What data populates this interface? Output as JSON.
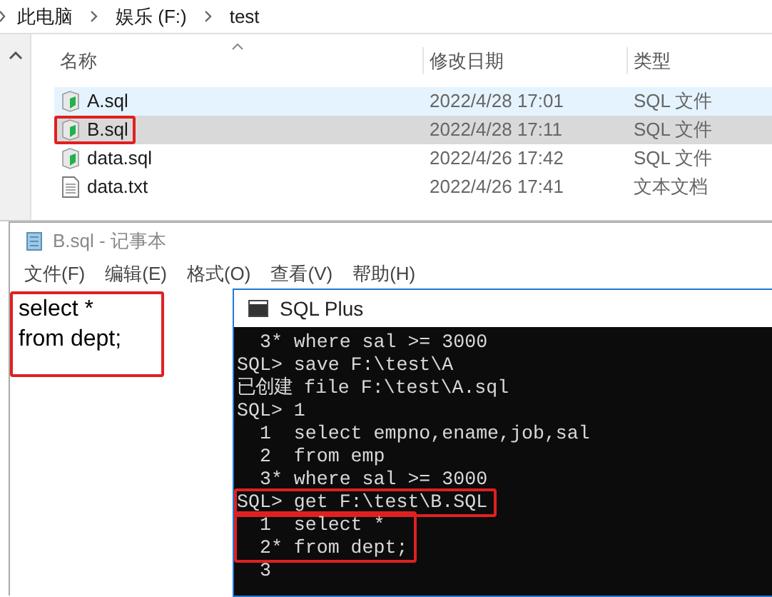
{
  "breadcrumb": [
    "此电脑",
    "娱乐 (F:)",
    "test"
  ],
  "explorer": {
    "columns": [
      "名称",
      "修改日期",
      "类型"
    ],
    "rows": [
      {
        "name": "A.sql",
        "date": "2022/4/28 17:01",
        "type": "SQL 文件",
        "kind": "sql",
        "hovered": true,
        "selected": false,
        "highlighted": false
      },
      {
        "name": "B.sql",
        "date": "2022/4/28 17:11",
        "type": "SQL 文件",
        "kind": "sql",
        "hovered": false,
        "selected": true,
        "highlighted": true
      },
      {
        "name": "data.sql",
        "date": "2022/4/26 17:42",
        "type": "SQL 文件",
        "kind": "sql",
        "hovered": false,
        "selected": false,
        "highlighted": false
      },
      {
        "name": "data.txt",
        "date": "2022/4/26 17:41",
        "type": "文本文档",
        "kind": "text",
        "hovered": false,
        "selected": false,
        "highlighted": false
      }
    ]
  },
  "notepad": {
    "title": "B.sql - 记事本",
    "menu": [
      "文件(F)",
      "编辑(E)",
      "格式(O)",
      "查看(V)",
      "帮助(H)"
    ],
    "content": {
      "lines": [
        "select *",
        "from dept;"
      ],
      "highlighted": true
    }
  },
  "sqlplus": {
    "title": "SQL Plus",
    "blocks": [
      {
        "highlighted": false,
        "lines": [
          "  3* where sal >= 3000",
          "SQL> save F:\\test\\A",
          "已创建 file F:\\test\\A.sql",
          "SQL> 1",
          "  1  select empno,ename,job,sal",
          "  2  from emp",
          "  3* where sal >= 3000"
        ]
      },
      {
        "highlighted": true,
        "lines": [
          "SQL> get F:\\test\\B.SQL"
        ]
      },
      {
        "highlighted": true,
        "lines": [
          "  1  select *",
          "  2* from dept;"
        ]
      },
      {
        "highlighted": false,
        "lines": [
          "  3"
        ]
      }
    ]
  }
}
